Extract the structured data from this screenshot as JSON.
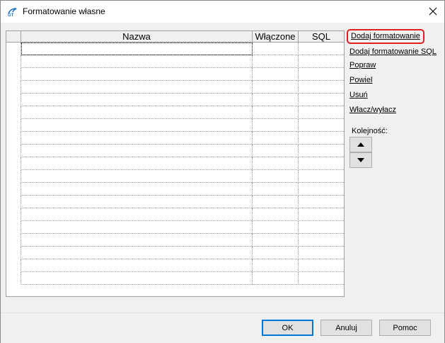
{
  "window": {
    "title": "Formatowanie własne",
    "close_glyph": "✕"
  },
  "grid": {
    "columns": [
      "",
      "Nazwa",
      "Włączone",
      "SQL"
    ],
    "row_count": 19
  },
  "actions": {
    "add": "Dodaj formatowanie",
    "add_sql": "Dodaj formatowanie SQL",
    "edit": "Popraw",
    "duplicate": "Powiel",
    "delete": "Usuń",
    "toggle": "Włacz/wyłacz"
  },
  "order": {
    "label": "Kolejność:",
    "up_icon": "triangle-up-icon",
    "down_icon": "triangle-down-icon"
  },
  "buttons": {
    "ok": "OK",
    "cancel": "Anuluj",
    "help": "Pomoc"
  },
  "colors": {
    "highlight": "#e02020",
    "default_button_border": "#0078d7",
    "icon_blue": "#1a6fc4"
  }
}
